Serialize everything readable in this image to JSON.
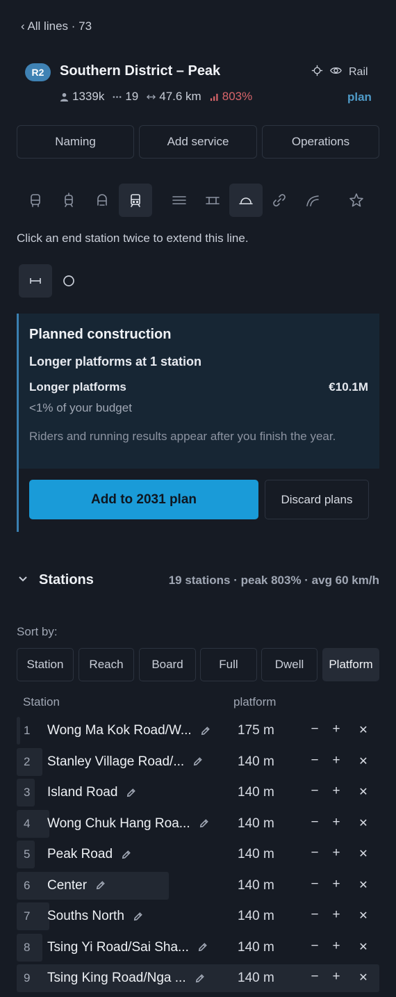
{
  "header": {
    "back_label": "‹ All lines · 73",
    "badge": "R2",
    "line_name": "Southern District – Peak",
    "mode_label": "Rail",
    "stats": {
      "riders": "1339k",
      "stations": "19",
      "length": "47.6 km",
      "load": "803%"
    },
    "plan_link": "plan"
  },
  "tabs": [
    "Naming",
    "Add service",
    "Operations"
  ],
  "mode_icons": [
    "bus-icon",
    "tram-icon",
    "metro-icon",
    "train-icon",
    "track-lines-icon",
    "bridge-icon",
    "tunnel-icon",
    "link-icon",
    "curve-track-icon",
    "star-icon"
  ],
  "hint": "Click an end station twice to extend this line.",
  "extend_icons": [
    "linear-extend-icon",
    "loop-extend-icon"
  ],
  "planned": {
    "title": "Planned construction",
    "subtitle": "Longer platforms at 1 station",
    "item": "Longer platforms",
    "cost": "€10.1M",
    "budget": "<1% of your budget",
    "note": "Riders and running results appear after you finish the year.",
    "add_label": "Add to 2031 plan",
    "discard_label": "Discard plans"
  },
  "stations": {
    "title": "Stations",
    "summary": "19 stations · peak 803% · avg 60 km/h",
    "sort_label": "Sort by:",
    "sort_options": [
      "Station",
      "Reach",
      "Board",
      "Full",
      "Dwell",
      "Platform"
    ],
    "sort_active": "Platform",
    "col_station": "Station",
    "col_platform": "platform",
    "rows": [
      {
        "num": "1",
        "name": "Wong Ma Kok Road/W...",
        "platform": "175 m",
        "reach": 0.01
      },
      {
        "num": "2",
        "name": "Stanley Village Road/...",
        "platform": "140 m",
        "reach": 0.07
      },
      {
        "num": "3",
        "name": "Island Road",
        "platform": "140 m",
        "reach": 0.05
      },
      {
        "num": "4",
        "name": "Wong Chuk Hang Roa...",
        "platform": "140 m",
        "reach": 0.09
      },
      {
        "num": "5",
        "name": "Peak Road",
        "platform": "140 m",
        "reach": 0.05
      },
      {
        "num": "6",
        "name": "Center",
        "platform": "140 m",
        "reach": 0.42
      },
      {
        "num": "7",
        "name": "Souths North",
        "platform": "140 m",
        "reach": 0.09
      },
      {
        "num": "8",
        "name": "Tsing Yi Road/Sai Sha...",
        "platform": "140 m",
        "reach": 0.07
      },
      {
        "num": "9",
        "name": "Tsing King Road/Nga ...",
        "platform": "140 m",
        "reach": 1.0
      }
    ],
    "controls": {
      "minus": "−",
      "plus": "+",
      "remove": "✕"
    }
  }
}
